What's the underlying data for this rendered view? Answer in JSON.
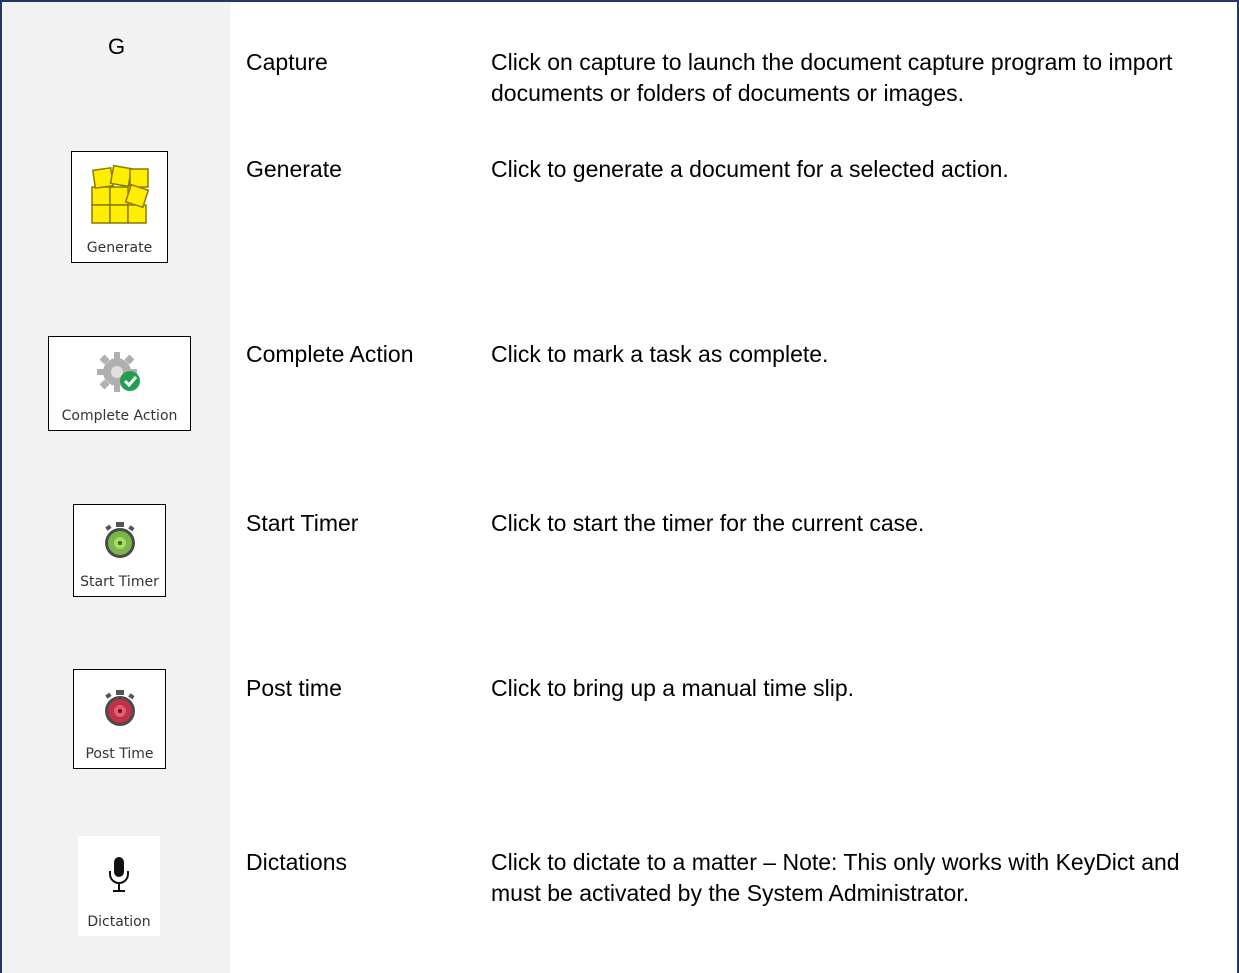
{
  "section_letter": "G",
  "rows": [
    {
      "term": "Capture",
      "description": "Click on capture to launch the document capture program to import documents or folders of documents or images."
    },
    {
      "term": "Generate",
      "description": "Click to generate a document for a selected action.",
      "icon_label": "Generate",
      "icon": "generate-icon"
    },
    {
      "term": "Complete Action",
      "description": "Click to mark a task as complete.",
      "icon_label": "Complete Action",
      "icon": "complete-action-icon"
    },
    {
      "term": "Start Timer",
      "description": "Click to start the timer for the current case.",
      "icon_label": "Start Timer",
      "icon": "start-timer-icon"
    },
    {
      "term": "Post time",
      "description": "Click to bring up a manual time slip.",
      "icon_label": "Post Time",
      "icon": "post-time-icon"
    },
    {
      "term": "Dictations",
      "description": "Click to dictate to a matter – Note:  This only works with KeyDict and must be activated by the System Administrator.",
      "icon_label": "Dictation",
      "icon": "microphone-icon"
    }
  ],
  "colors": {
    "frame": "#1f3864",
    "icon_column": "#f2f2f2"
  }
}
